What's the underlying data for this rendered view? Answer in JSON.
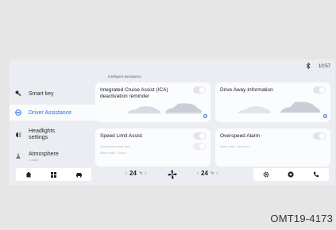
{
  "status": {
    "time": "10:57",
    "signal_icon": "bluetooth-icon"
  },
  "sidebar": {
    "items": [
      {
        "label": "Smart key",
        "sub": "",
        "icon": "key-icon"
      },
      {
        "label": "Driver Assistance",
        "sub": "",
        "icon": "steering-icon"
      },
      {
        "label": "Headlights settings",
        "sub": "",
        "icon": "headlight-icon"
      },
      {
        "label": "Atmosphere",
        "sub": "1 color",
        "icon": "atmosphere-icon"
      }
    ],
    "active_index": 1
  },
  "main": {
    "section_title": "Intelligent assistance",
    "cards": [
      {
        "title": "Integrated Cruise Assist (ICA) deactivation reminder",
        "toggle_on": false
      },
      {
        "title": "Drive Away Information",
        "toggle_on": false
      },
      {
        "title": "Speed Limit Assist",
        "toggle_on": false,
        "faint_line_1": "Speed limit change alert",
        "faint_line_2": "Alarm mode · Close >"
      },
      {
        "title": "Overspeed Alarm",
        "toggle_on": false,
        "faint_line_1": "Alarm value · Alarm on >"
      }
    ]
  },
  "dock": {
    "left_temp": "24",
    "right_temp": "24",
    "temp_unit": "°c",
    "chev_left": "‹",
    "chev_right": "›"
  },
  "figure_code": "OMT19-4173",
  "colors": {
    "accent": "#2d6fe0",
    "background": "#ebedf2",
    "card": "#fbfcfe"
  }
}
